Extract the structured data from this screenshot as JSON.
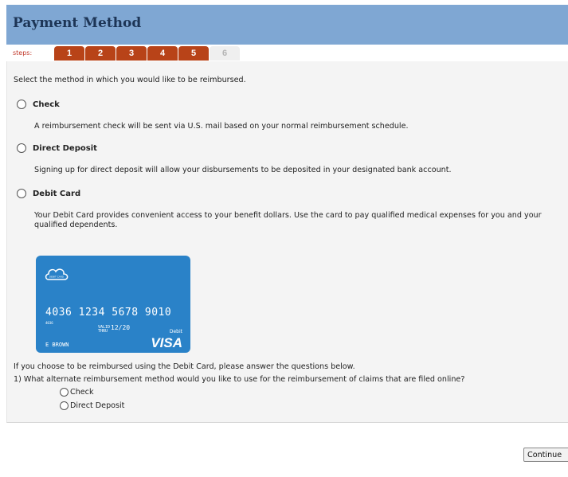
{
  "header": {
    "title": "Payment Method"
  },
  "steps": {
    "label": "steps:",
    "items": [
      "1",
      "2",
      "3",
      "4",
      "5",
      "6"
    ]
  },
  "main": {
    "intro": "Select the method in which you would like to be reimbursed.",
    "options": [
      {
        "label": "Check",
        "description": "A reimbursement check will be sent via U.S. mail based on your normal reimbursement schedule."
      },
      {
        "label": "Direct Deposit",
        "description": "Signing up for direct deposit will allow your disbursements to be deposited in your designated bank account."
      },
      {
        "label": "Debit Card",
        "description": "Your Debit Card provides convenient access to your benefit dollars. Use the card to pay qualified medical expenses for you and your qualified dependents."
      }
    ],
    "card": {
      "logo_text": "DEBIT CARD",
      "number": "4036 1234 5678 9010",
      "small": "4036",
      "valid_label": "VALID\nTHRU",
      "expiry": "12/20",
      "type": "Debit",
      "name": "E BROWN",
      "brand": "VISA"
    },
    "debit_note": "If you choose to be reimbursed using the Debit Card, please answer the questions below.",
    "question": "1) What alternate reimbursement method would you like to use for the reimbursement of claims that are filed online?",
    "alt_options": [
      "Check",
      "Direct Deposit"
    ]
  },
  "footer": {
    "continue_label": "Continue"
  },
  "colors": {
    "header_bg": "#7fa7d3",
    "step_active": "#b84318",
    "card_bg": "#2a82c8"
  }
}
